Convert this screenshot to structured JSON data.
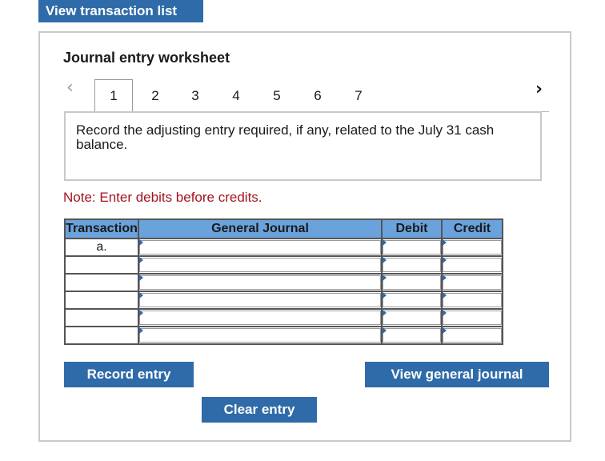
{
  "header": {
    "view_transaction_list_label": "View transaction list"
  },
  "worksheet": {
    "title": "Journal entry worksheet",
    "pager": {
      "tabs": [
        "1",
        "2",
        "3",
        "4",
        "5",
        "6",
        "7"
      ],
      "active_tab": "1",
      "prev_icon": "chevron-left-icon",
      "next_icon": "chevron-right-icon"
    },
    "instruction": "Record the adjusting entry required, if any, related to the July 31 cash balance.",
    "note": "Note: Enter debits before credits.",
    "table": {
      "columns": [
        "Transaction",
        "General Journal",
        "Debit",
        "Credit"
      ],
      "rows": [
        {
          "transaction": "a.",
          "account": "",
          "debit": "",
          "credit": ""
        },
        {
          "transaction": "",
          "account": "",
          "debit": "",
          "credit": ""
        },
        {
          "transaction": "",
          "account": "",
          "debit": "",
          "credit": ""
        },
        {
          "transaction": "",
          "account": "",
          "debit": "",
          "credit": ""
        },
        {
          "transaction": "",
          "account": "",
          "debit": "",
          "credit": ""
        },
        {
          "transaction": "",
          "account": "",
          "debit": "",
          "credit": ""
        }
      ]
    },
    "buttons": {
      "record_entry": "Record entry",
      "clear_entry": "Clear entry",
      "view_general_journal": "View general journal"
    }
  },
  "colors": {
    "button_blue": "#2f6ba8",
    "header_blue": "#6aa3dc",
    "note_red": "#a3141f",
    "border_gray": "#c9c9c9"
  }
}
